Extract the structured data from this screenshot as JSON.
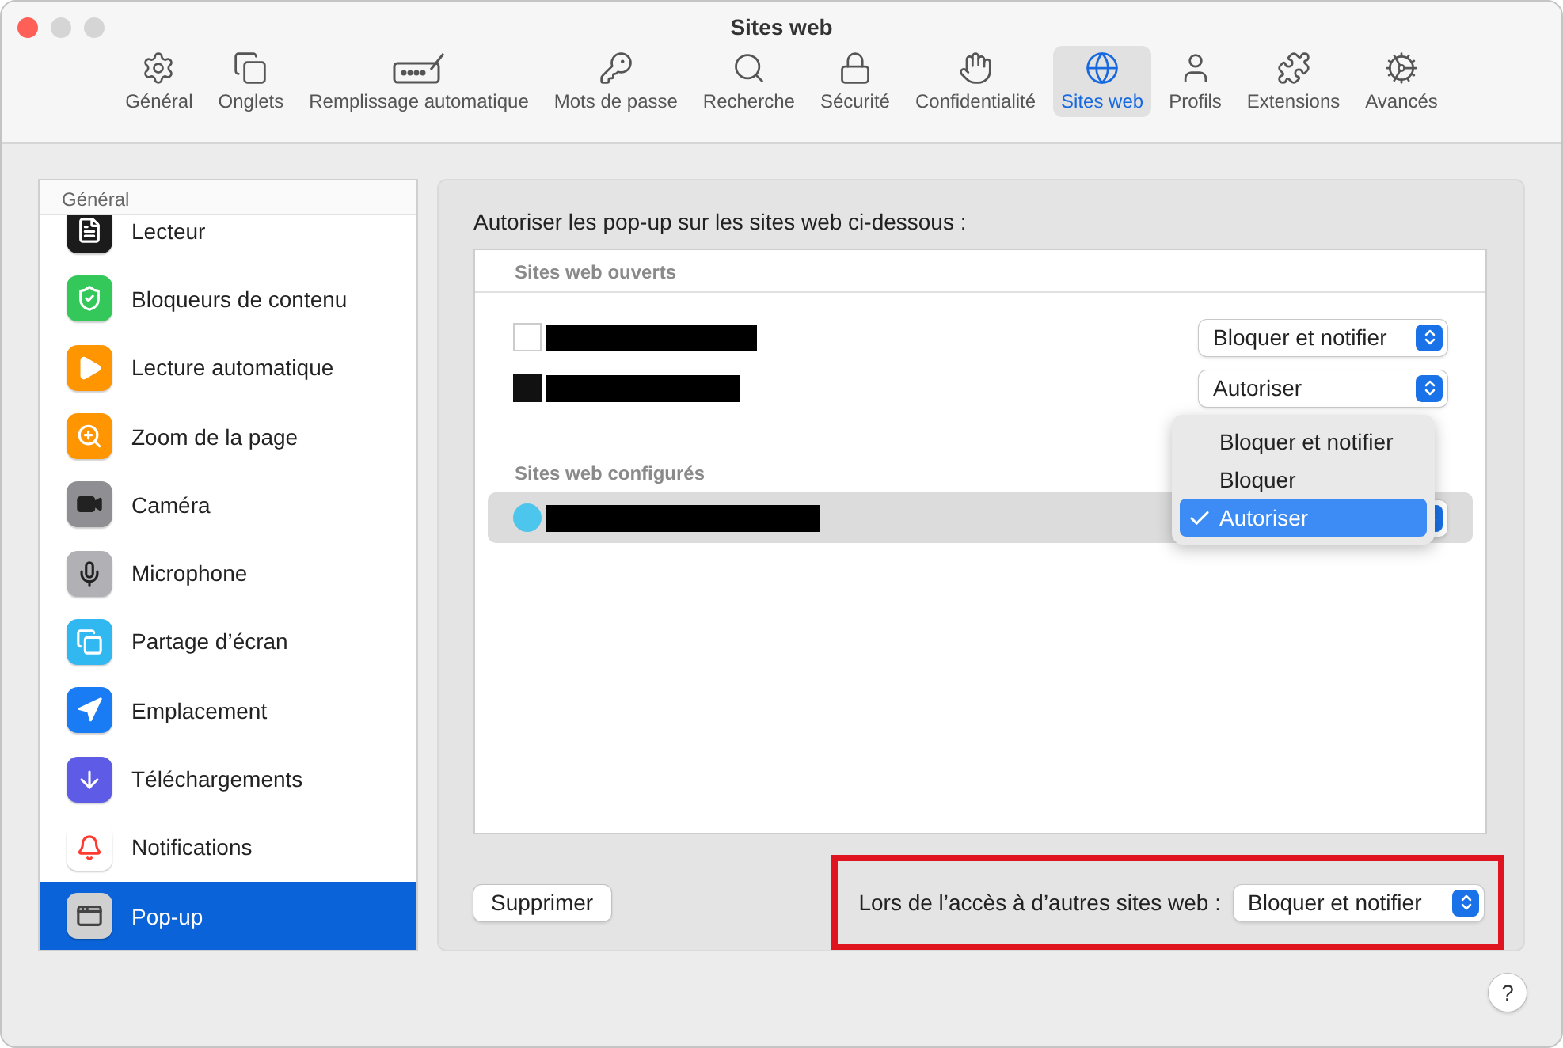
{
  "window": {
    "title": "Sites web"
  },
  "toolbar": {
    "items": [
      {
        "kind": "general",
        "label": "Général",
        "selected": false
      },
      {
        "kind": "tabs",
        "label": "Onglets",
        "selected": false
      },
      {
        "kind": "autofill",
        "label": "Remplissage automatique",
        "selected": false
      },
      {
        "kind": "passwords",
        "label": "Mots de passe",
        "selected": false
      },
      {
        "kind": "search",
        "label": "Recherche",
        "selected": false
      },
      {
        "kind": "security",
        "label": "Sécurité",
        "selected": false
      },
      {
        "kind": "privacy",
        "label": "Confidentialité",
        "selected": false
      },
      {
        "kind": "websites",
        "label": "Sites web",
        "selected": true
      },
      {
        "kind": "profiles",
        "label": "Profils",
        "selected": false
      },
      {
        "kind": "extensions",
        "label": "Extensions",
        "selected": false
      },
      {
        "kind": "advanced",
        "label": "Avancés",
        "selected": false
      }
    ]
  },
  "sidebar": {
    "section": "Général",
    "items": [
      {
        "kind": "reader",
        "label": "Lecteur",
        "selected": false
      },
      {
        "kind": "blockers",
        "label": "Bloqueurs de contenu",
        "selected": false
      },
      {
        "kind": "autoplay",
        "label": "Lecture automatique",
        "selected": false
      },
      {
        "kind": "zoom",
        "label": "Zoom de la page",
        "selected": false
      },
      {
        "kind": "camera",
        "label": "Caméra",
        "selected": false
      },
      {
        "kind": "microphone",
        "label": "Microphone",
        "selected": false
      },
      {
        "kind": "screen",
        "label": "Partage d’écran",
        "selected": false
      },
      {
        "kind": "location",
        "label": "Emplacement",
        "selected": false
      },
      {
        "kind": "downloads",
        "label": "Téléchargements",
        "selected": false
      },
      {
        "kind": "notifications",
        "label": "Notifications",
        "selected": false
      },
      {
        "kind": "popup",
        "label": "Pop-up",
        "selected": true
      }
    ]
  },
  "panel": {
    "heading": "Autoriser les pop-up sur les sites web ci-dessous :",
    "sections": [
      {
        "title": "Sites web ouverts",
        "sites": [
          {
            "kind": "square",
            "setting": "Bloquer et notifier",
            "selected": false
          },
          {
            "kind": "dark",
            "setting": "Autoriser",
            "selected": false
          }
        ]
      },
      {
        "title": "Sites web configurés",
        "sites": [
          {
            "kind": "round",
            "selected": true
          }
        ]
      }
    ],
    "menu": {
      "items": [
        {
          "label": "Bloquer et notifier",
          "selected": false
        },
        {
          "label": "Bloquer",
          "selected": false
        },
        {
          "label": "Autoriser",
          "selected": true
        }
      ]
    },
    "remove_button": "Supprimer",
    "other_sites": {
      "label": "Lors de l’accès à d’autres sites web :",
      "value": "Bloquer et notifier",
      "highlighted": true
    }
  },
  "help": "?"
}
